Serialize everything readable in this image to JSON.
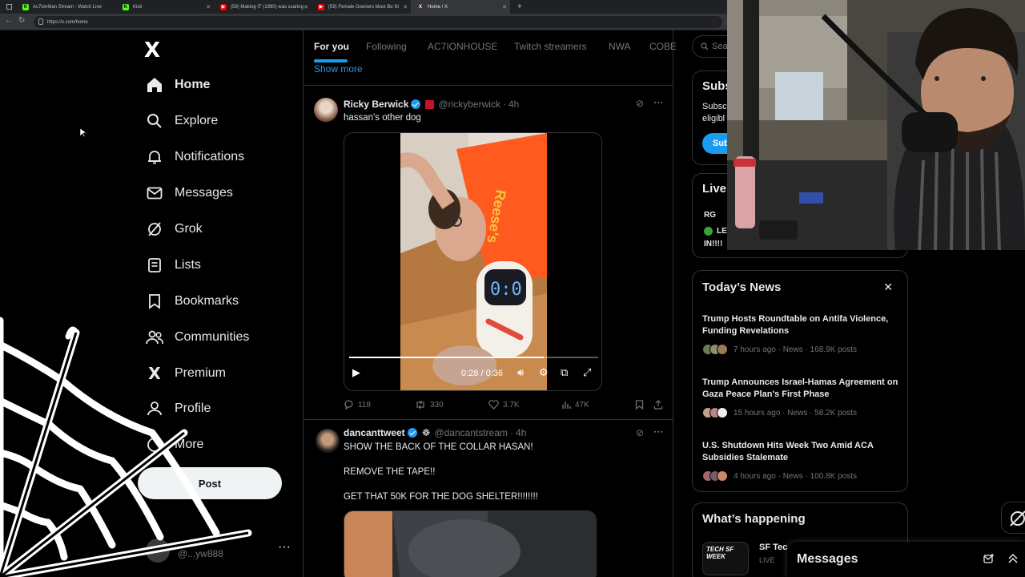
{
  "browser": {
    "tabs": [
      {
        "title": "Ac7ionMan Stream - Watch Live",
        "fav": "K",
        "color": "#53fc18"
      },
      {
        "title": "Kick",
        "fav": "K",
        "color": "#53fc18"
      },
      {
        "title": "(59) Making IT (1990) was scaring",
        "fav": "▶",
        "color": "#ff0000"
      },
      {
        "title": "(59) Female Gooners Must Be St",
        "fav": "▶",
        "color": "#ff0000"
      },
      {
        "title": "Home / X",
        "fav": "X",
        "color": "#ffffff"
      }
    ],
    "new_tab": "+",
    "url": "https://x.com/home"
  },
  "sidebar": {
    "logo": "X",
    "items": [
      {
        "label": "Home",
        "icon": "home-icon"
      },
      {
        "label": "Explore",
        "icon": "search-icon"
      },
      {
        "label": "Notifications",
        "icon": "bell-icon"
      },
      {
        "label": "Messages",
        "icon": "envelope-icon"
      },
      {
        "label": "Grok",
        "icon": "grok-icon"
      },
      {
        "label": "Lists",
        "icon": "list-icon"
      },
      {
        "label": "Bookmarks",
        "icon": "bookmark-icon"
      },
      {
        "label": "Communities",
        "icon": "people-icon"
      },
      {
        "label": "Premium",
        "icon": "x-icon"
      },
      {
        "label": "Profile",
        "icon": "person-icon"
      },
      {
        "label": "More",
        "icon": "more-circle-icon"
      }
    ],
    "post_label": "Post",
    "account_handle": "@...yw888",
    "account_more": "···"
  },
  "feed": {
    "tabs": [
      "For you",
      "Following",
      "AC7IONHOUSE",
      "Twitch streamers",
      "NWA",
      "COBE"
    ],
    "show_more": "Show more",
    "tweets": [
      {
        "name": "Ricky Berwick",
        "handle": "@rickyberwick",
        "time": "4h",
        "text": "hassan's other dog",
        "video_time": "0:28 / 0:36",
        "video_progress": 0.78,
        "replies": "118",
        "reposts": "330",
        "likes": "3.7K",
        "views": "47K"
      },
      {
        "name": "dancanttweet",
        "handle": "@dancantstream",
        "time": "4h",
        "lines": [
          "SHOW THE BACK OF THE COLLAR HASAN!",
          "REMOVE THE TAPE!!",
          "GET THAT 50K FOR THE DOG SHELTER!!!!!!!!"
        ]
      }
    ]
  },
  "right": {
    "search_placeholder": "Sea",
    "subscribe": {
      "title": "Subs",
      "line1": "Subsc",
      "line2": "eligibl",
      "button": "Sub"
    },
    "live": {
      "title": "Live",
      "row1": "RG",
      "row2": "LE",
      "row3": "IN!!!!"
    },
    "todays_news": {
      "title": "Today’s News",
      "close": "✕",
      "items": [
        {
          "title": "Trump Hosts Roundtable on Antifa Violence, Funding Revelations",
          "meta": "7 hours ago · News · 168.9K posts"
        },
        {
          "title": "Trump Announces Israel-Hamas Agreement on Gaza Peace Plan's First Phase",
          "meta": "15 hours ago · News · 58.2K posts"
        },
        {
          "title": "U.S. Shutdown Hits Week Two Amid ACA Subsidies Stalemate",
          "meta": "4 hours ago · News · 100.8K posts"
        }
      ]
    },
    "whats_happening": {
      "title": "What’s happening",
      "item_title": "SF Tec",
      "item_live": "LIVE",
      "thumb_text": "TECH SF WEEK"
    }
  },
  "messages_drawer": {
    "title": "Messages"
  }
}
